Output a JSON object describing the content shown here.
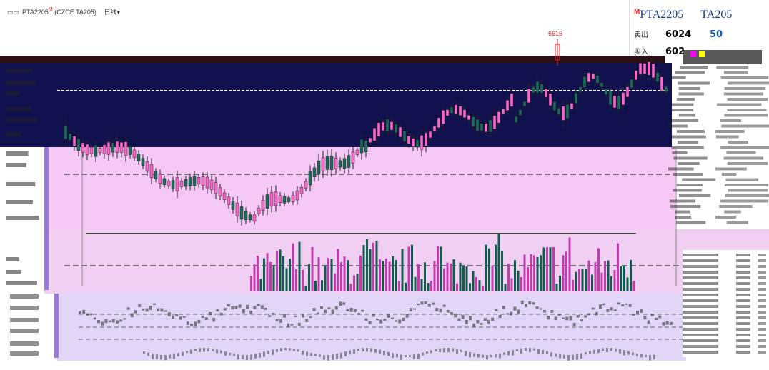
{
  "window": {
    "icon": "window-icon",
    "symbol": "PTA2205",
    "symbol_sup": "M",
    "exchange": "(CZCE TA205)",
    "period": "日线",
    "dropdown_icon": "chevron-down-icon"
  },
  "quote": {
    "flag": "M",
    "name": "PTA2205",
    "code": "TA205",
    "ask_label": "卖出",
    "ask_price": "6024",
    "ask_volume": "50",
    "bid_label": "买入",
    "bid_price": "602"
  },
  "chart": {
    "peak_label": "6616"
  },
  "colors": {
    "navy": "#11114f",
    "pink": "#f5c8f5",
    "lavender": "#e1d6f7",
    "accent_red": "#d22222",
    "quote_blue": "#1b3f8a"
  }
}
